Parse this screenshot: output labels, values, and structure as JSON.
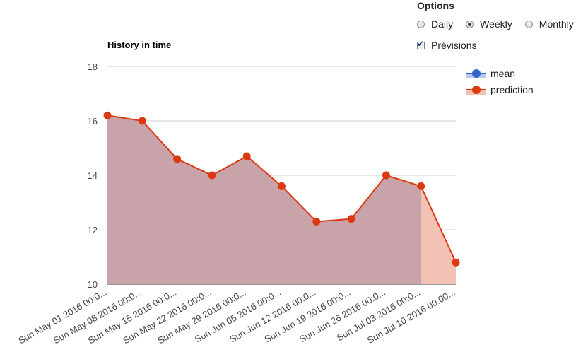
{
  "options": {
    "title": "Options",
    "radios": [
      {
        "label": "Daily",
        "checked": false
      },
      {
        "label": "Weekly",
        "checked": true
      },
      {
        "label": "Monthly",
        "checked": false
      }
    ],
    "checkbox": {
      "label": "Prévisions",
      "checked": true
    }
  },
  "chart_data": {
    "type": "area",
    "title": "History in time",
    "xlabel": "",
    "ylabel": "",
    "ylim": [
      10,
      18
    ],
    "yticks": [
      10,
      12,
      14,
      16,
      18
    ],
    "grid": true,
    "legend": "right",
    "categories": [
      "Sun May 01 2016 00:0...",
      "Sun May 08 2016 00:0...",
      "Sun May 15 2016 00:0...",
      "Sun May 22 2016 00:0...",
      "Sun May 29 2016 00:0...",
      "Sun Jun 05 2016 00:0...",
      "Sun Jun 12 2016 00:0...",
      "Sun Jun 19 2016 00:0...",
      "Sun Jun 26 2016 00:0...",
      "Sun Jul 03 2016 00:0...",
      "Sun Jul 10 2016 00:00..."
    ],
    "series": [
      {
        "name": "mean",
        "color": "#3366cc",
        "values": []
      },
      {
        "name": "prediction",
        "color": "#dc3912",
        "values": [
          16.2,
          16.0,
          14.6,
          14.0,
          14.7,
          13.6,
          12.3,
          12.4,
          14.0,
          13.6,
          10.8
        ]
      }
    ],
    "history_fill": "#c9a3aa",
    "forecast_fill": "#f2c2b5",
    "forecast_start_index": 9
  }
}
